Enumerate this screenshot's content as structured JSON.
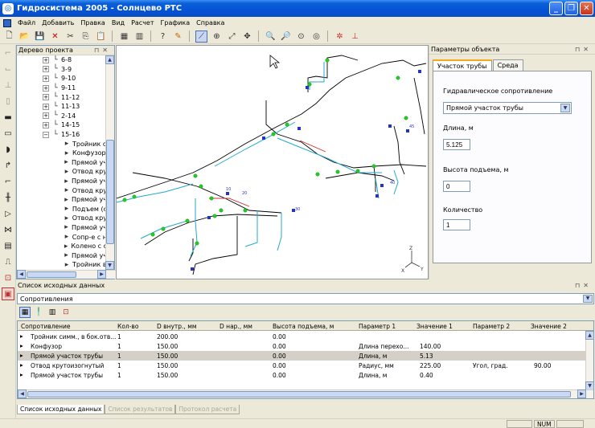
{
  "window": {
    "title": "Гидросистема 2005 - Солнцево РТС"
  },
  "menu": [
    "Файл",
    "Добавить",
    "Правка",
    "Вид",
    "Расчет",
    "Графика",
    "Справка"
  ],
  "toolbar": {
    "icons": [
      "new-file-icon",
      "open-folder-icon",
      "save-icon",
      "delete-icon",
      "cut-icon",
      "copy-icon",
      "paste-icon",
      "grid-view-icon",
      "columns-icon",
      "help-icon",
      "pipe-check-icon",
      "draw-pipe-icon",
      "zoom-icon",
      "select-icon",
      "move-icon",
      "zoom-in-icon",
      "zoom-out-icon",
      "zoom-fit-icon",
      "zoom-window-icon",
      "settings-icon",
      "axis-icon"
    ]
  },
  "left_tools": [
    "pipe-tool-icon",
    "valve-tool-icon",
    "tee-tool-icon",
    "support-tool-icon",
    "straight-pipe-icon",
    "reducer-icon",
    "cap-icon",
    "bend-icon",
    "elbow-icon",
    "flange-icon",
    "confusor-icon",
    "gate-valve-icon",
    "compensator-icon",
    "lift-icon",
    "pump-icon",
    "layer-icon"
  ],
  "tree": {
    "title": "Дерево проекта",
    "nodes": [
      {
        "label": "6-8",
        "type": "branch"
      },
      {
        "label": "3-9",
        "type": "branch"
      },
      {
        "label": "9-10",
        "type": "branch"
      },
      {
        "label": "9-11",
        "type": "branch"
      },
      {
        "label": "11-12",
        "type": "branch"
      },
      {
        "label": "11-13",
        "type": "branch"
      },
      {
        "label": "2-14",
        "type": "branch"
      },
      {
        "label": "14-15",
        "type": "branch"
      },
      {
        "label": "15-16",
        "type": "branch-open"
      },
      {
        "label": "Тройник с",
        "type": "leaf"
      },
      {
        "label": "Конфузор",
        "type": "leaf"
      },
      {
        "label": "Прямой уч",
        "type": "leaf"
      },
      {
        "label": "Отвод кру",
        "type": "leaf"
      },
      {
        "label": "Прямой уч",
        "type": "leaf"
      },
      {
        "label": "Отвод кру",
        "type": "leaf"
      },
      {
        "label": "Прямой уч",
        "type": "leaf"
      },
      {
        "label": "Подъем (с",
        "type": "leaf"
      },
      {
        "label": "Отвод кру",
        "type": "leaf"
      },
      {
        "label": "Прямой уч",
        "type": "leaf"
      },
      {
        "label": "Сопр-е с н",
        "type": "leaf"
      },
      {
        "label": "Колено с с",
        "type": "leaf"
      },
      {
        "label": "Прямой уч",
        "type": "leaf"
      },
      {
        "label": "Тройник в",
        "type": "leaf"
      }
    ]
  },
  "props": {
    "title": "Параметры объекта",
    "tabs": [
      "Участок трубы",
      "Среда"
    ],
    "hydraulic_label": "Гидравлическое сопротивление",
    "hydraulic_value": "Прямой участок трубы",
    "length_label": "Длина, м",
    "length_value": "5.125",
    "height_label": "Высота подъема, м",
    "height_value": "0",
    "count_label": "Количество",
    "count_value": "1"
  },
  "data_list": {
    "title": "Список исходных данных",
    "dropdown": "Сопротивления",
    "columns": [
      "Сопротивление",
      "Кол-во",
      "D внутр., мм",
      "D нар., мм",
      "Высота подъема, м",
      "Параметр 1",
      "Значение 1",
      "Параметр 2",
      "Значение 2"
    ],
    "rows": [
      {
        "name": "Тройник симм., в бок.отв...",
        "qty": "1",
        "din": "200.00",
        "dout": "",
        "h": "0.00",
        "p1": "",
        "v1": "",
        "p2": "",
        "v2": ""
      },
      {
        "name": "Конфузор",
        "qty": "1",
        "din": "150.00",
        "dout": "",
        "h": "0.00",
        "p1": "Длина перехо...",
        "v1": "140.00",
        "p2": "",
        "v2": ""
      },
      {
        "name": "Прямой участок трубы",
        "qty": "1",
        "din": "150.00",
        "dout": "",
        "h": "0.00",
        "p1": "Длина, м",
        "v1": "5.13",
        "p2": "",
        "v2": ""
      },
      {
        "name": "Отвод крутоизогнутый",
        "qty": "1",
        "din": "150.00",
        "dout": "",
        "h": "0.00",
        "p1": "Радиус, мм",
        "v1": "225.00",
        "p2": "Угол, град.",
        "v2": "90.00"
      },
      {
        "name": "Прямой участок трубы",
        "qty": "1",
        "din": "150.00",
        "dout": "",
        "h": "0.00",
        "p1": "Длина, м",
        "v1": "0.40",
        "p2": "",
        "v2": ""
      }
    ],
    "bottom_tabs": [
      "Список исходных данных",
      "Список результатов",
      "Протокол расчета"
    ]
  },
  "status": {
    "num": "NUM"
  },
  "canvas": {
    "axis_labels": [
      "X",
      "Y",
      "Z"
    ],
    "node_labels": [
      "10",
      "20",
      "30",
      "40",
      "45"
    ]
  }
}
